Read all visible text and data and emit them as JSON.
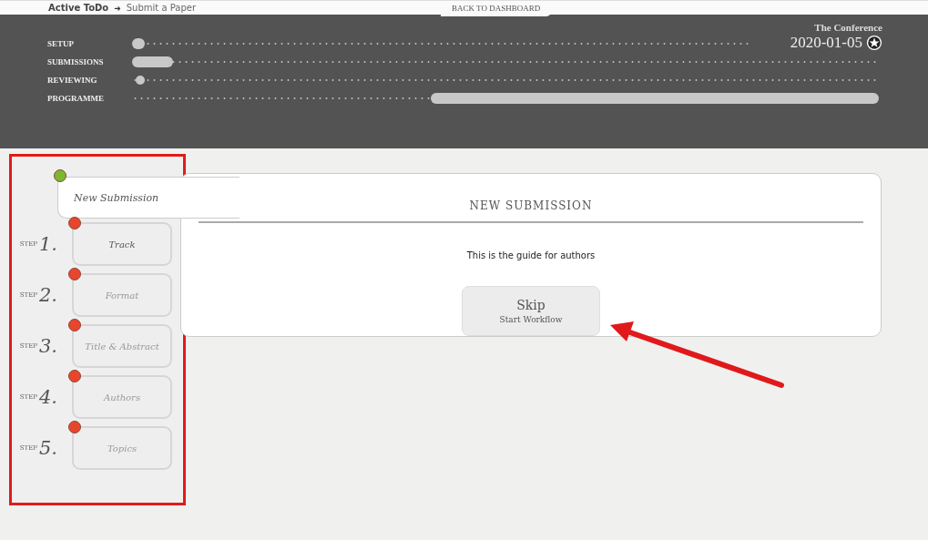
{
  "breadcrumb": {
    "current": "Active ToDo",
    "separator": "➜",
    "next": "Submit a Paper"
  },
  "back_link": "BACK TO DASHBOARD",
  "conference": {
    "name": "The Conference",
    "date": "2020-01-05"
  },
  "timeline": [
    {
      "label": "SETUP",
      "kind": "start",
      "level": 0.02
    },
    {
      "label": "SUBMISSIONS",
      "kind": "start",
      "level": 0.055
    },
    {
      "label": "REVIEWING",
      "kind": "marker",
      "level": 0.01
    },
    {
      "label": "PROGRAMME",
      "kind": "end",
      "level": 0.6
    }
  ],
  "wizard": {
    "root": {
      "label": "New Submission",
      "color": "#7cb82f"
    },
    "steps": [
      {
        "prefix": "STEP",
        "number": "1.",
        "label": "Track",
        "color": "#e8452f",
        "disabled": false
      },
      {
        "prefix": "STEP",
        "number": "2.",
        "label": "Format",
        "color": "#e8452f",
        "disabled": true
      },
      {
        "prefix": "STEP",
        "number": "3.",
        "label": "Title & Abstract",
        "color": "#e8452f",
        "disabled": true
      },
      {
        "prefix": "STEP",
        "number": "4.",
        "label": "Authors",
        "color": "#e8452f",
        "disabled": true
      },
      {
        "prefix": "STEP",
        "number": "5.",
        "label": "Topics",
        "color": "#e8452f",
        "disabled": true
      }
    ]
  },
  "panel": {
    "title": "NEW SUBMISSION",
    "text": "This is the guide for authors",
    "button": {
      "label": "Skip",
      "sublabel": "Start Workflow"
    }
  }
}
